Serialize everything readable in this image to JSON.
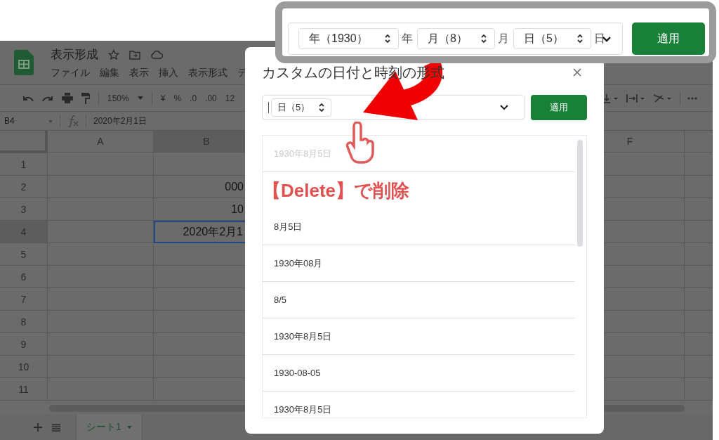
{
  "spreadsheet": {
    "title": "表示形成",
    "menu": [
      "ファイル",
      "編集",
      "表示",
      "挿入",
      "表示形式",
      "テ"
    ],
    "toolbar": {
      "zoom": "150%",
      "format_items": [
        "¥",
        "%",
        ".0",
        ".00",
        "12"
      ]
    },
    "formula_bar": {
      "cell_ref": "B4",
      "value": "2020年2月1日"
    },
    "columns": [
      {
        "label": "A",
        "selected": false
      },
      {
        "label": "B",
        "selected": true
      },
      {
        "label": "F",
        "selected": false
      }
    ],
    "rows": [
      {
        "number": "1",
        "selected": false
      },
      {
        "number": "2",
        "b": "000",
        "selected": false
      },
      {
        "number": "3",
        "b": "10",
        "selected": false
      },
      {
        "number": "4",
        "b": "2020年2月1",
        "selected": true
      },
      {
        "number": "5",
        "selected": false
      },
      {
        "number": "6",
        "selected": false
      },
      {
        "number": "7",
        "selected": false
      },
      {
        "number": "8",
        "selected": false
      },
      {
        "number": "9",
        "selected": false
      },
      {
        "number": "10",
        "selected": false
      },
      {
        "number": "11",
        "selected": false
      }
    ],
    "sheet_tabs": [
      {
        "label": "シート1",
        "selected": true
      }
    ]
  },
  "dialog": {
    "title": "カスタムの日付と時刻の形式",
    "tokens": [
      {
        "label": "日（5）"
      }
    ],
    "apply_label": "適用",
    "formats": [
      {
        "text": "1930年8月5日",
        "dimmed": true
      },
      {
        "text": "8月5日",
        "dimmed": false
      },
      {
        "text": "1930年08月",
        "dimmed": false
      },
      {
        "text": "8/5",
        "dimmed": false
      },
      {
        "text": "1930年8月5日",
        "dimmed": false
      },
      {
        "text": "1930-08-05",
        "dimmed": false
      },
      {
        "text": "1930年8月5日",
        "dimmed": false
      }
    ]
  },
  "annotation": {
    "text": "【Delete】で削除"
  },
  "callout": {
    "tokens": [
      {
        "label": "年（1930）",
        "suffix": "年"
      },
      {
        "label": "月（8）",
        "suffix": "月"
      },
      {
        "label": "日（5）",
        "suffix": "日"
      }
    ],
    "apply_label": "適用"
  }
}
